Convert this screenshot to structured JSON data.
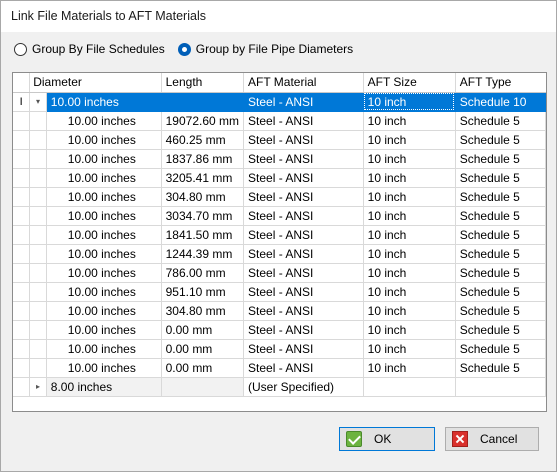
{
  "window": {
    "title": "Link File Materials to AFT Materials"
  },
  "grouping": {
    "options": [
      {
        "label": "Group By File Schedules",
        "selected": false
      },
      {
        "label": "Group by File Pipe Diameters",
        "selected": true
      }
    ]
  },
  "grid": {
    "columns": [
      "Diameter",
      "Length",
      "AFT Material",
      "AFT Size",
      "AFT Type"
    ],
    "groups": [
      {
        "diameter": "10.00 inches",
        "expanded": true,
        "selected": true,
        "material": "Steel - ANSI",
        "size": "10 inch",
        "type": "Schedule 10",
        "row_indicator": "I",
        "expander": "▾",
        "children": [
          {
            "diameter": "10.00 inches",
            "length": "19072.60 mm",
            "material": "Steel - ANSI",
            "size": "10 inch",
            "type": "Schedule 5"
          },
          {
            "diameter": "10.00 inches",
            "length": "460.25 mm",
            "material": "Steel - ANSI",
            "size": "10 inch",
            "type": "Schedule 5"
          },
          {
            "diameter": "10.00 inches",
            "length": "1837.86 mm",
            "material": "Steel - ANSI",
            "size": "10 inch",
            "type": "Schedule 5"
          },
          {
            "diameter": "10.00 inches",
            "length": "3205.41 mm",
            "material": "Steel - ANSI",
            "size": "10 inch",
            "type": "Schedule 5"
          },
          {
            "diameter": "10.00 inches",
            "length": "304.80 mm",
            "material": "Steel - ANSI",
            "size": "10 inch",
            "type": "Schedule 5"
          },
          {
            "diameter": "10.00 inches",
            "length": "3034.70 mm",
            "material": "Steel - ANSI",
            "size": "10 inch",
            "type": "Schedule 5"
          },
          {
            "diameter": "10.00 inches",
            "length": "1841.50 mm",
            "material": "Steel - ANSI",
            "size": "10 inch",
            "type": "Schedule 5"
          },
          {
            "diameter": "10.00 inches",
            "length": "1244.39 mm",
            "material": "Steel - ANSI",
            "size": "10 inch",
            "type": "Schedule 5"
          },
          {
            "diameter": "10.00 inches",
            "length": "786.00 mm",
            "material": "Steel - ANSI",
            "size": "10 inch",
            "type": "Schedule 5"
          },
          {
            "diameter": "10.00 inches",
            "length": "951.10 mm",
            "material": "Steel - ANSI",
            "size": "10 inch",
            "type": "Schedule 5"
          },
          {
            "diameter": "10.00 inches",
            "length": "304.80 mm",
            "material": "Steel - ANSI",
            "size": "10 inch",
            "type": "Schedule 5"
          },
          {
            "diameter": "10.00 inches",
            "length": "0.00 mm",
            "material": "Steel - ANSI",
            "size": "10 inch",
            "type": "Schedule 5"
          },
          {
            "diameter": "10.00 inches",
            "length": "0.00 mm",
            "material": "Steel - ANSI",
            "size": "10 inch",
            "type": "Schedule 5"
          },
          {
            "diameter": "10.00 inches",
            "length": "0.00 mm",
            "material": "Steel - ANSI",
            "size": "10 inch",
            "type": "Schedule 5"
          }
        ]
      },
      {
        "diameter": "8.00 inches",
        "expanded": false,
        "selected": false,
        "material": "(User Specified)",
        "size": "",
        "type": "",
        "expander": "▸",
        "children": []
      }
    ]
  },
  "buttons": {
    "ok": {
      "label": "OK",
      "icon": "checkmark-icon",
      "color": "#6cb33f"
    },
    "cancel": {
      "label": "Cancel",
      "icon": "close-icon",
      "color": "#d9302c"
    }
  },
  "colors": {
    "selection": "#0078d7",
    "dialog_bg": "#f0f0f0"
  }
}
